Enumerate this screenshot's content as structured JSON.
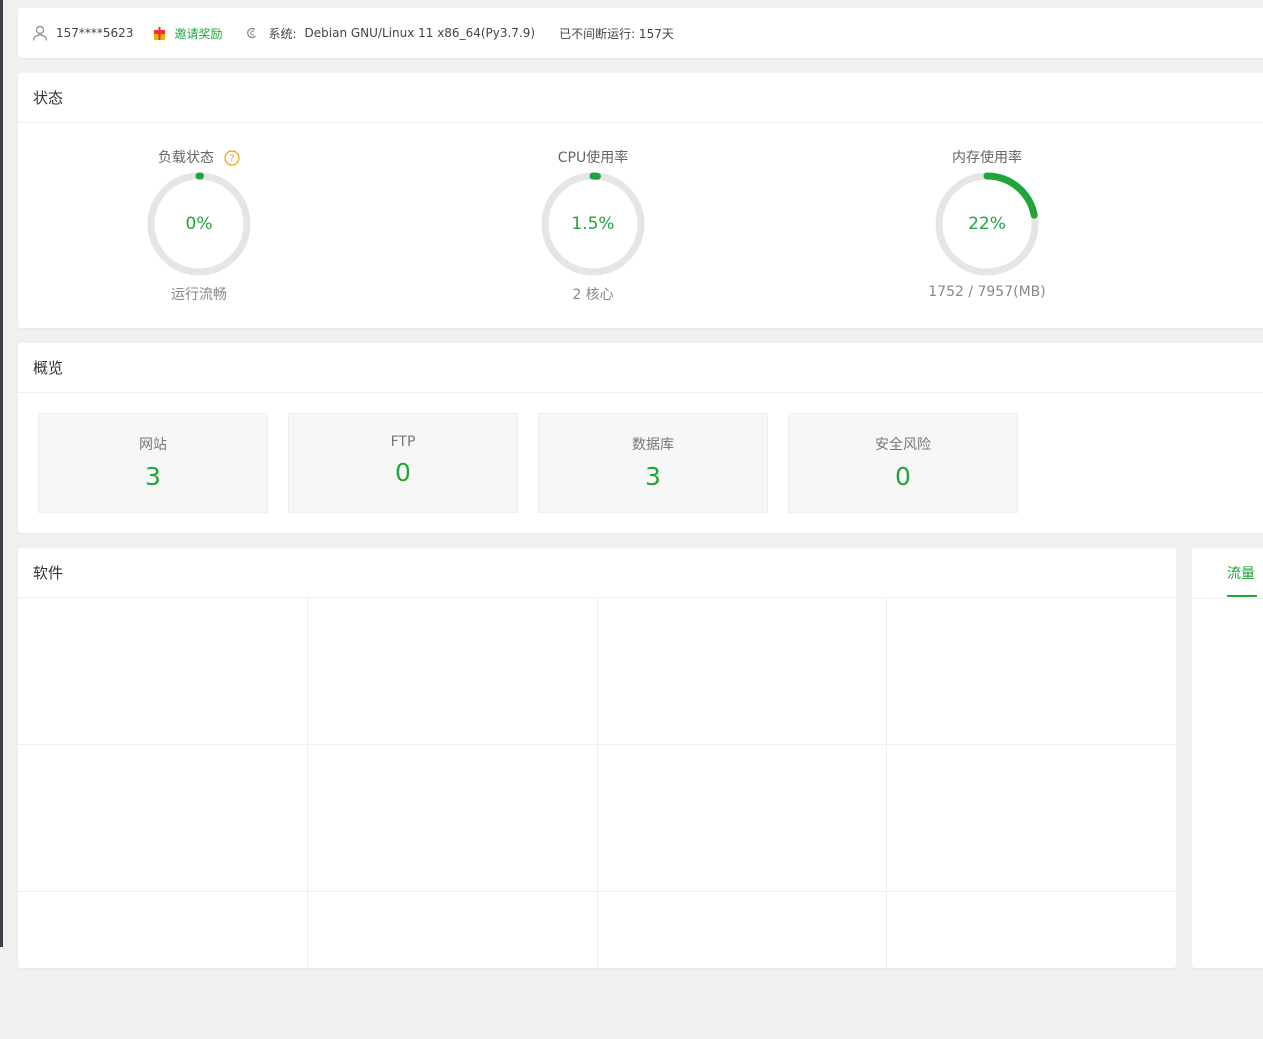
{
  "topbar": {
    "user": "157****5623",
    "invite": "邀请奖励",
    "system_label": "系统:",
    "system_value": "Debian GNU/Linux 11 x86_64(Py3.7.9)",
    "uptime": "已不间断运行: 157天"
  },
  "status": {
    "title": "状态",
    "gauges": [
      {
        "title": "负载状态",
        "value": "0%",
        "percent": 0.5,
        "sub": "运行流畅"
      },
      {
        "title": "CPU使用率",
        "value": "1.5%",
        "percent": 1.5,
        "sub": "2 核心"
      },
      {
        "title": "内存使用率",
        "value": "22%",
        "percent": 22,
        "sub": "1752 / 7957(MB)"
      }
    ]
  },
  "overview": {
    "title": "概览",
    "items": [
      {
        "label": "网站",
        "value": "3"
      },
      {
        "label": "FTP",
        "value": "0"
      },
      {
        "label": "数据库",
        "value": "3"
      },
      {
        "label": "安全风险",
        "value": "0"
      }
    ]
  },
  "software": {
    "title": "软件"
  },
  "traffic": {
    "tab": "流量"
  },
  "colors": {
    "accent": "#20a53a",
    "ring_bg": "#e5e5e5",
    "help": "#f39c12"
  }
}
